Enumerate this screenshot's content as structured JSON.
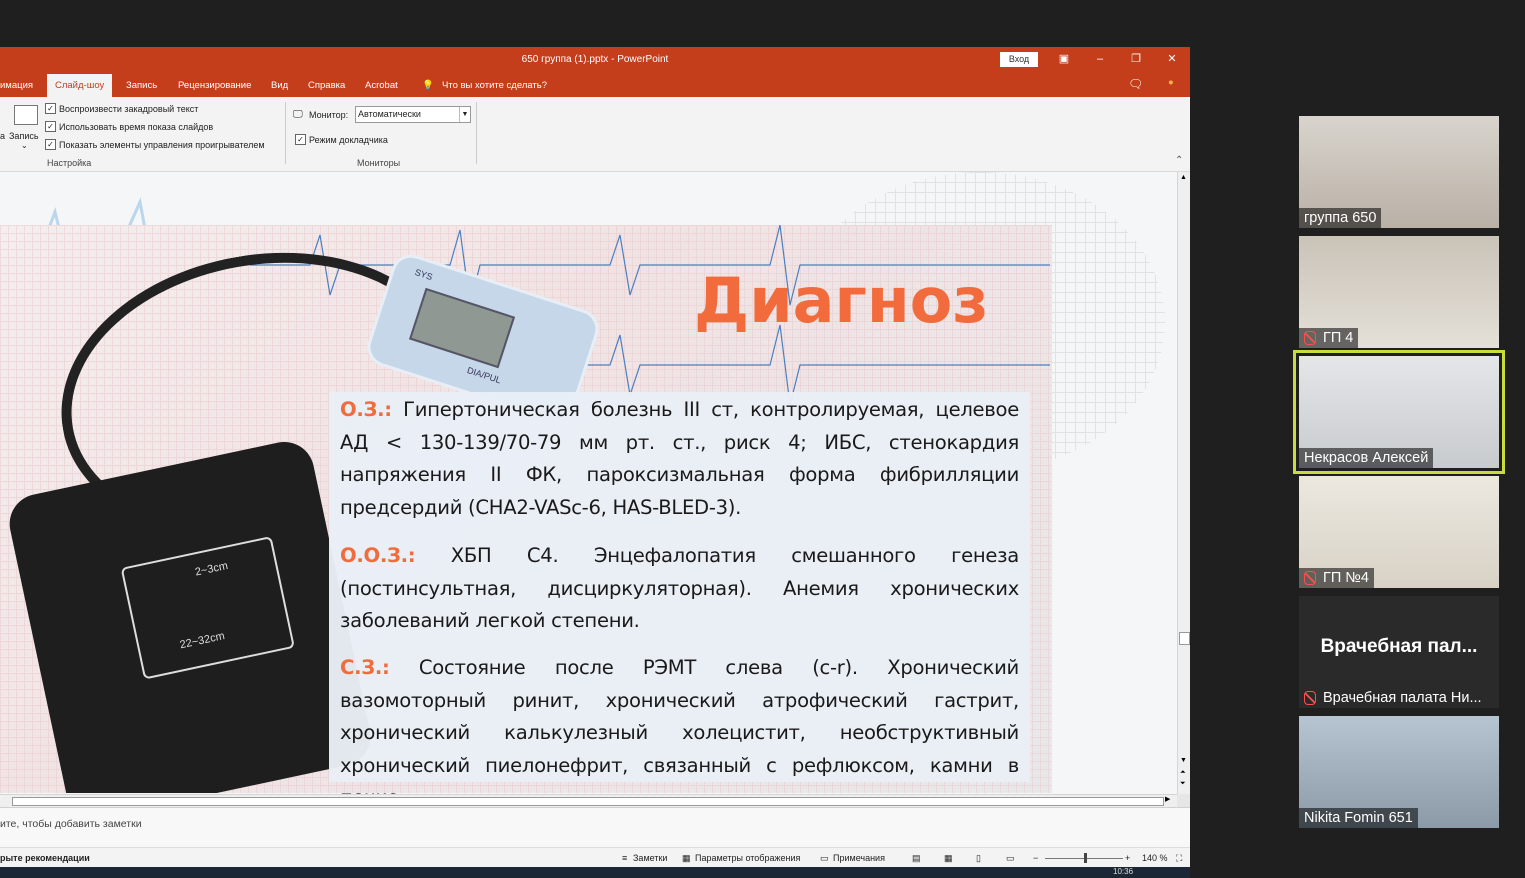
{
  "window": {
    "title": "650 группа (1).pptx  -  PowerPoint",
    "login_label": "Вход",
    "minimize": "–",
    "restore": "❐",
    "close": "✕"
  },
  "tabs": [
    {
      "label": "имация"
    },
    {
      "label": "Слайд-шоу"
    },
    {
      "label": "Запись"
    },
    {
      "label": "Рецензирование"
    },
    {
      "label": "Вид"
    },
    {
      "label": "Справка"
    },
    {
      "label": "Acrobat"
    },
    {
      "label": "Что вы хотите сделать?"
    }
  ],
  "ribbon": {
    "record_label": "Запись",
    "record_left": "а",
    "checkbox_narration": "Воспроизвести закадровый текст",
    "checkbox_timings": "Использовать время показа слайдов",
    "checkbox_controls": "Показать элементы управления проигрывателем",
    "group_setup": "Настройка",
    "monitor_label": "Монитор:",
    "monitor_value": "Автоматически",
    "presenter_view": "Режим докладчика",
    "group_monitors": "Мониторы"
  },
  "slide": {
    "title": "Диагноз",
    "oz_label": "О.З.:",
    "oz_text": " Гипертоническая болезнь III ст, контролируемая, целевое АД < 130-139/70-79 мм рт. ст., риск 4; ИБС, стенокардия напряжения II ФК, пароксизмальная форма фибрилляции предсердий (CHA2-VASc-6, HAS-BLED-3).",
    "ooz_label": "О.О.З.:",
    "ooz_text": " ХБП С4. Энцефалопатия смешанного генеза (постинсультная, дисциркуляторная). Анемия хронических заболеваний легкой степени.",
    "sz_label": "С.З.:",
    "sz_text": "  Состояние после РЭМТ слева (c-r). Хронический вазомоторный ринит, хронический атрофический гастрит, хронический калькулезный холецистит, необструктивный хронический пиелонефрит, связанный с рефлюксом, камни в почке.",
    "cuff_text_1": "2~3cm",
    "cuff_text_2": "22~32cm",
    "device_sys": "SYS",
    "device_dia": "DIA/PUL"
  },
  "notes_placeholder": "ите, чтобы добавить заметки",
  "status": {
    "left": "рыте рекомендации",
    "notes": "Заметки",
    "display_settings": "Параметры отображения",
    "comments": "Примечания",
    "zoom": "140 %",
    "time": "10:36"
  },
  "participants": [
    {
      "name": "группа 650",
      "muted": false,
      "speaking": false
    },
    {
      "name": "ГП 4",
      "muted": true,
      "speaking": false
    },
    {
      "name": "Некрасов Алексей",
      "muted": false,
      "speaking": true
    },
    {
      "name": "ГП №4",
      "muted": true,
      "speaking": false
    },
    {
      "name": "Врачебная палата Ни...",
      "muted": true,
      "speaking": false,
      "big_label": "Врачебная пал..."
    },
    {
      "name": "Nikita Fomin 651",
      "muted": false,
      "speaking": false
    }
  ],
  "colors": {
    "ppt_accent": "#c43e1c",
    "slide_title": "#f26b3c",
    "speaking_outline": "#c8dc3c"
  }
}
